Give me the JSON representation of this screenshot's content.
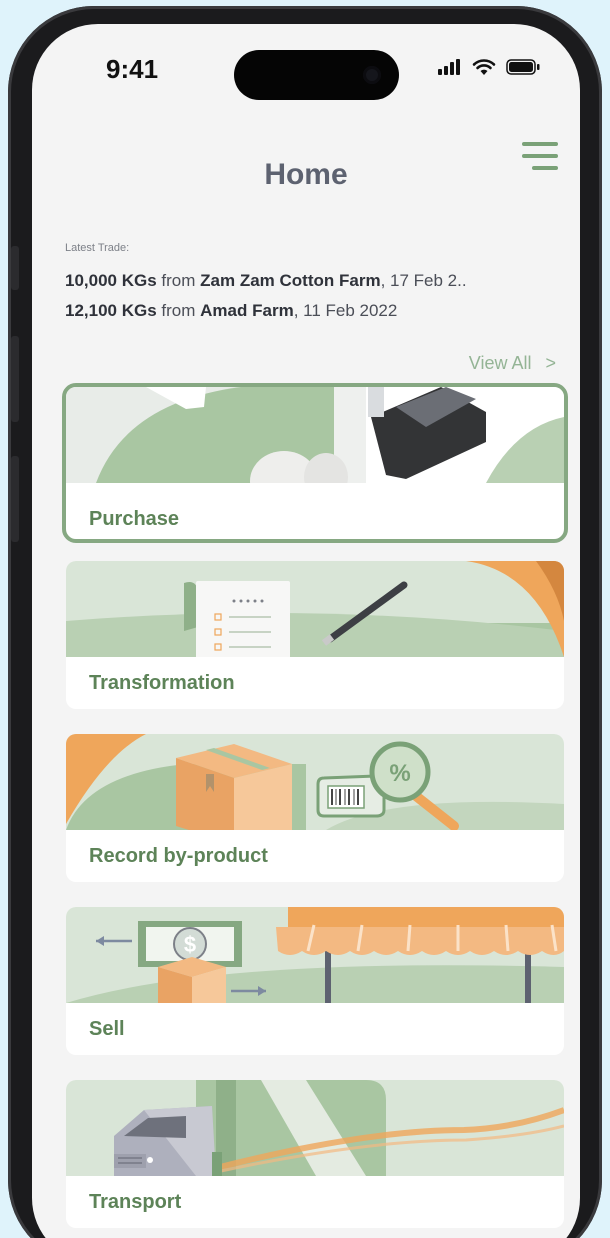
{
  "status_bar": {
    "time": "9:41"
  },
  "header": {
    "title": "Home"
  },
  "latest_trade": {
    "label": "Latest Trade:",
    "trades": [
      {
        "quantity": "10,000 KGs",
        "connector": "from",
        "farm": "Zam Zam Cotton Farm",
        "date": ", 17 Feb 2.."
      },
      {
        "quantity": "12,100 KGs",
        "connector": "from",
        "farm": "Amad Farm",
        "date": ", 11 Feb 2022"
      }
    ],
    "view_all_label": "View All",
    "view_all_chevron": ">"
  },
  "cards": [
    {
      "label": "Purchase",
      "illustration": "payment-terminal",
      "selected": true
    },
    {
      "label": "Transformation",
      "illustration": "checklist-pen",
      "selected": false
    },
    {
      "label": "Record by-product",
      "illustration": "box-barcode-percent",
      "selected": false
    },
    {
      "label": "Sell",
      "illustration": "money-box-awning",
      "selected": false
    },
    {
      "label": "Transport",
      "illustration": "truck-road",
      "selected": false
    }
  ],
  "colors": {
    "accent_green": "#7aa177",
    "card_label": "#5d8358",
    "art_bg": "#d9e5d7",
    "art_green": "#a9c6a2",
    "art_orange": "#efa65b",
    "phone_frame": "#1b1b1d"
  },
  "icons": [
    "signal-icon",
    "wifi-icon",
    "battery-icon",
    "menu-icon",
    "chevron-right-icon"
  ]
}
